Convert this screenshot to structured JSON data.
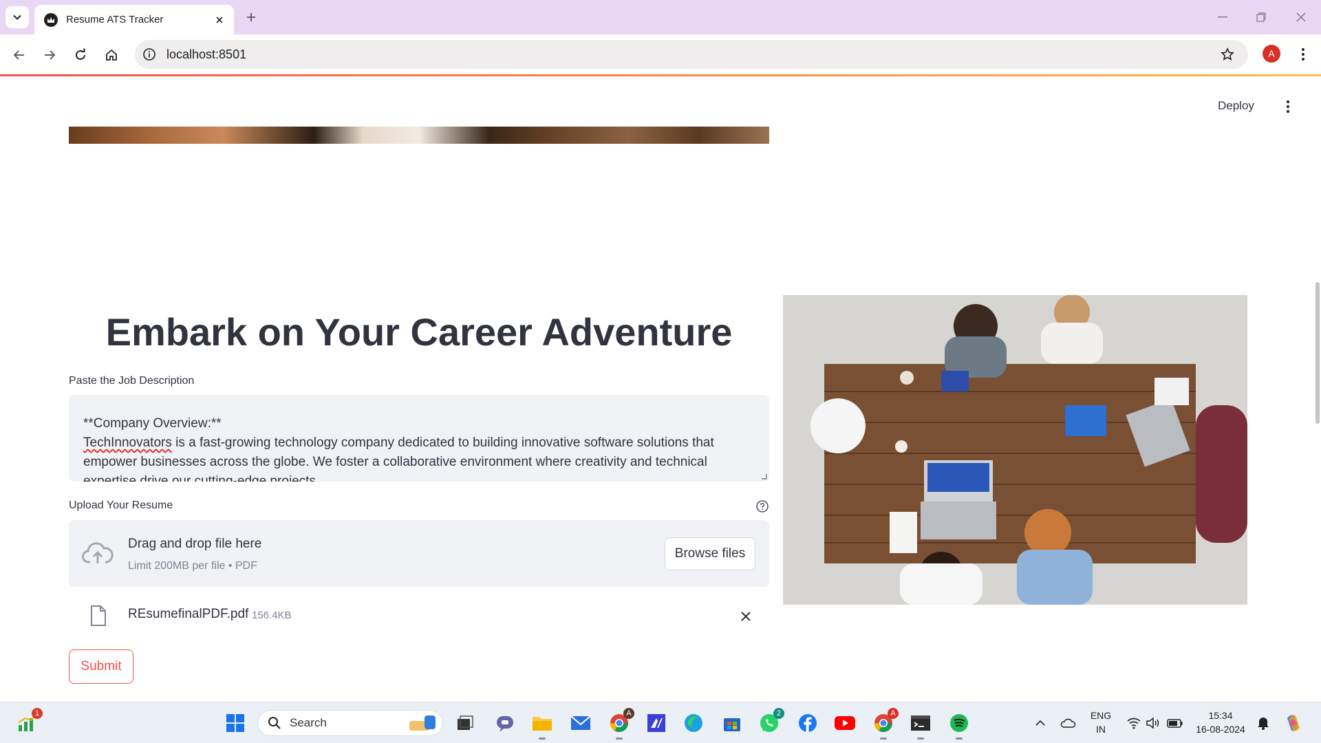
{
  "browser": {
    "tab_title": "Resume ATS Tracker",
    "url": "localhost:8501",
    "profile_initial": "A"
  },
  "app": {
    "deploy_label": "Deploy",
    "title": "Embark on Your Career Adventure",
    "job_description": {
      "label": "Paste the Job Description",
      "lines": [
        "**Company Overview:**",
        "TechInnovators",
        " is a fast-growing technology company dedicated to building innovative software solutions that",
        "empower businesses across the globe. We foster a collaborative environment where creativity and technical",
        "expertise drive our cutting-edge projects."
      ]
    },
    "upload": {
      "label": "Upload Your Resume",
      "drop_title": "Drag and drop file here",
      "drop_limit": "Limit 200MB per file • PDF",
      "browse_label": "Browse files",
      "file_name": "REsumefinalPDF.pdf",
      "file_size": "156.4KB"
    },
    "submit_label": "Submit"
  },
  "taskbar": {
    "search_placeholder": "Search",
    "notification_badge": "1",
    "whatsapp_badge": "2",
    "chrome_badge": "A",
    "language_top": "ENG",
    "language_bottom": "IN",
    "time": "15:34",
    "date": "16-08-2024"
  },
  "colors": {
    "accent": "#ff4b4b",
    "tabstrip": "#e8d8f6",
    "input_bg": "#f0f2f6"
  }
}
